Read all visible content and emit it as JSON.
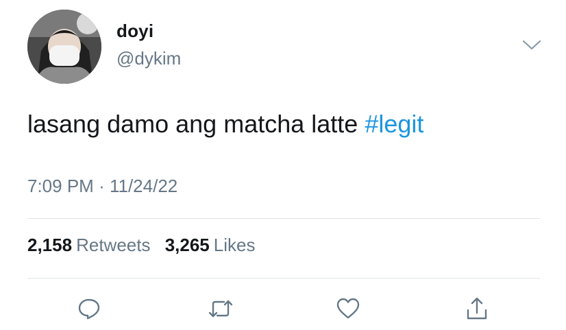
{
  "user": {
    "display_name": "doyi",
    "handle": "@dykim"
  },
  "tweet": {
    "text": "lasang damo ang matcha latte ",
    "hashtag": "#legit",
    "time": "7:09 PM",
    "separator": "·",
    "date": "11/24/22"
  },
  "stats": {
    "retweets_count": "2,158",
    "retweets_label": "Retweets",
    "likes_count": "3,265",
    "likes_label": "Likes"
  },
  "icons": {
    "menu": "chevron-down-icon",
    "reply": "reply-icon",
    "retweet": "retweet-icon",
    "like": "heart-icon",
    "share": "share-icon"
  },
  "colors": {
    "text": "#14171a",
    "secondary": "#657786",
    "link": "#1b95e0",
    "divider": "#dfe4e8"
  }
}
